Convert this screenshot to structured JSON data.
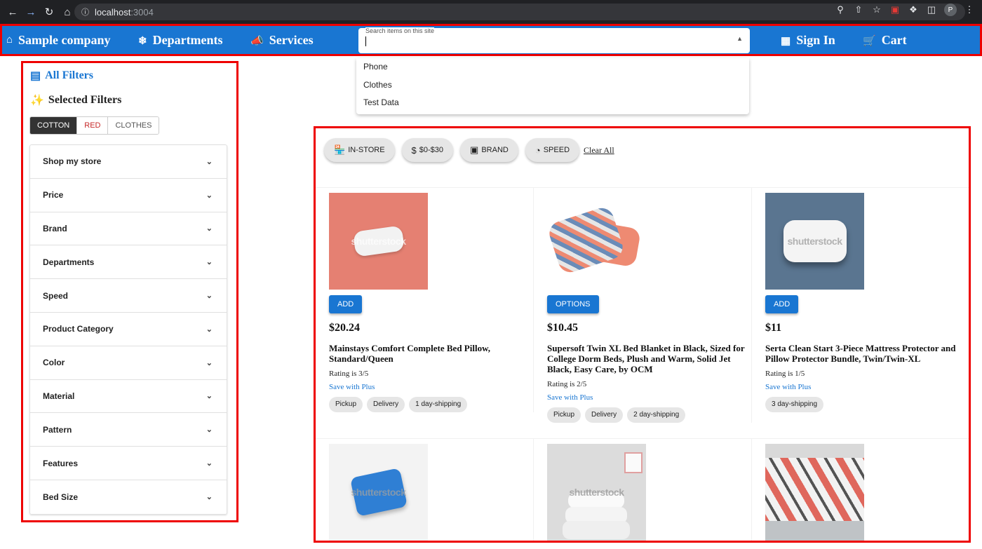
{
  "browser": {
    "url_host": "localhost",
    "url_port": ":3004",
    "profile_initial": "P"
  },
  "appbar": {
    "company": "Sample company",
    "departments": "Departments",
    "services": "Services",
    "search_label": "Search items on this site",
    "sign_in": "Sign In",
    "cart": "Cart",
    "color": "#1976d2"
  },
  "search_options": [
    "Phone",
    "Clothes",
    "Test Data"
  ],
  "sidebar": {
    "all_filters": "All Filters",
    "selected_filters": "Selected Filters",
    "chips": [
      "COTTON",
      "RED",
      "CLOTHES"
    ],
    "accordion": [
      "Shop my store",
      "Price",
      "Brand",
      "Departments",
      "Speed",
      "Product Category",
      "Color",
      "Material",
      "Pattern",
      "Features",
      "Bed Size"
    ]
  },
  "quick_filters": {
    "items": [
      "IN-STORE",
      "$0-$30",
      "BRAND",
      "SPEED"
    ],
    "clear_all": "Clear All"
  },
  "products": [
    {
      "button": "ADD",
      "price": "$20.24",
      "name": "Mainstays Comfort Complete Bed Pillow, Standard/Queen",
      "rating": "Rating is 3/5",
      "plus": "Save with Plus",
      "tags": [
        "Pickup",
        "Delivery",
        "1 day-shipping"
      ]
    },
    {
      "button": "OPTIONS",
      "price": "$10.45",
      "name": "Supersoft Twin XL Bed Blanket in Black, Sized for College Dorm Beds, Plush and Warm, Solid Jet Black, Easy Care, by OCM",
      "rating": "Rating is 2/5",
      "plus": "Save with Plus",
      "tags": [
        "Pickup",
        "Delivery",
        "2 day-shipping"
      ]
    },
    {
      "button": "ADD",
      "price": "$11",
      "name": "Serta Clean Start 3-Piece Mattress Protector and Pillow Protector Bundle, Twin/Twin-XL",
      "rating": "Rating is 1/5",
      "plus": "Save with Plus",
      "tags": [
        "3 day-shipping"
      ]
    }
  ],
  "watermark": "shutterstock"
}
